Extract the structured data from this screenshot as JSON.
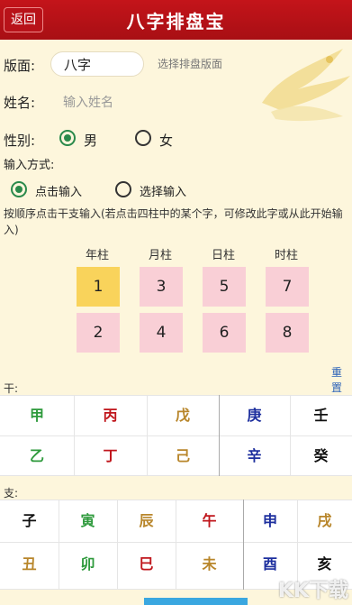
{
  "header": {
    "back_label": "返回",
    "title": "八字排盘宝"
  },
  "form": {
    "pan_label": "版面:",
    "pan_value": "八字",
    "pan_hint": "选择排盘版面",
    "name_label": "姓名:",
    "name_placeholder": "输入姓名",
    "gender_label": "性别:",
    "gender_male": "男",
    "gender_female": "女",
    "input_mode_label": "输入方式:",
    "mode_click": "点击输入",
    "mode_select": "选择输入",
    "instruction": "按顺序点击干支输入(若点击四柱中的某个字，可修改此字或从此开始输入)"
  },
  "pillars": {
    "headers": [
      "年柱",
      "月柱",
      "日柱",
      "时柱"
    ],
    "top": [
      "1",
      "3",
      "5",
      "7"
    ],
    "bottom": [
      "2",
      "4",
      "6",
      "8"
    ],
    "selected_index": 0
  },
  "reset_label": "重置",
  "stems": {
    "label": "干:",
    "row1": [
      {
        "t": "甲",
        "c": "#2e9a3c"
      },
      {
        "t": "丙",
        "c": "#c0161c"
      },
      {
        "t": "戊",
        "c": "#b8862b"
      },
      {
        "t": "庚",
        "c": "#1d2f9e"
      },
      {
        "t": "壬",
        "c": "#111111"
      }
    ],
    "row2": [
      {
        "t": "乙",
        "c": "#2e9a3c"
      },
      {
        "t": "丁",
        "c": "#c0161c"
      },
      {
        "t": "己",
        "c": "#b8862b"
      },
      {
        "t": "辛",
        "c": "#1d2f9e"
      },
      {
        "t": "癸",
        "c": "#111111"
      }
    ]
  },
  "branches": {
    "label": "支:",
    "row1": [
      {
        "t": "子",
        "c": "#111111"
      },
      {
        "t": "寅",
        "c": "#2e9a3c"
      },
      {
        "t": "辰",
        "c": "#b8862b"
      },
      {
        "t": "午",
        "c": "#c0161c"
      },
      {
        "t": "申",
        "c": "#1d2f9e"
      },
      {
        "t": "戌",
        "c": "#b8862b"
      }
    ],
    "row2": [
      {
        "t": "丑",
        "c": "#b8862b"
      },
      {
        "t": "卯",
        "c": "#2e9a3c"
      },
      {
        "t": "巳",
        "c": "#c0161c"
      },
      {
        "t": "未",
        "c": "#b8862b"
      },
      {
        "t": "酉",
        "c": "#1d2f9e"
      },
      {
        "t": "亥",
        "c": "#111111"
      }
    ]
  },
  "watermark": "KK下载"
}
